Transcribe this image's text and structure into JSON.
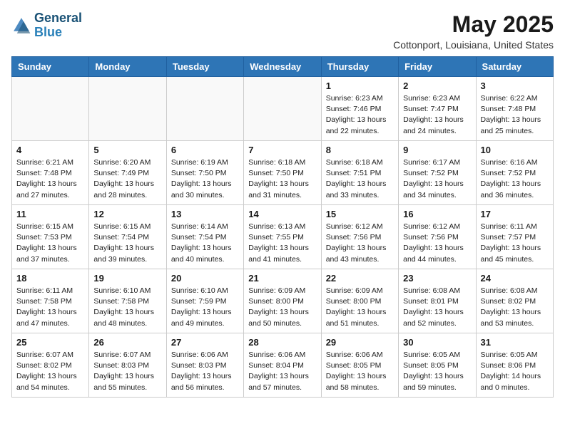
{
  "logo": {
    "line1": "General",
    "line2": "Blue"
  },
  "title": "May 2025",
  "location": "Cottonport, Louisiana, United States",
  "days_of_week": [
    "Sunday",
    "Monday",
    "Tuesday",
    "Wednesday",
    "Thursday",
    "Friday",
    "Saturday"
  ],
  "weeks": [
    [
      {
        "day": "",
        "info": ""
      },
      {
        "day": "",
        "info": ""
      },
      {
        "day": "",
        "info": ""
      },
      {
        "day": "",
        "info": ""
      },
      {
        "day": "1",
        "info": "Sunrise: 6:23 AM\nSunset: 7:46 PM\nDaylight: 13 hours\nand 22 minutes."
      },
      {
        "day": "2",
        "info": "Sunrise: 6:23 AM\nSunset: 7:47 PM\nDaylight: 13 hours\nand 24 minutes."
      },
      {
        "day": "3",
        "info": "Sunrise: 6:22 AM\nSunset: 7:48 PM\nDaylight: 13 hours\nand 25 minutes."
      }
    ],
    [
      {
        "day": "4",
        "info": "Sunrise: 6:21 AM\nSunset: 7:48 PM\nDaylight: 13 hours\nand 27 minutes."
      },
      {
        "day": "5",
        "info": "Sunrise: 6:20 AM\nSunset: 7:49 PM\nDaylight: 13 hours\nand 28 minutes."
      },
      {
        "day": "6",
        "info": "Sunrise: 6:19 AM\nSunset: 7:50 PM\nDaylight: 13 hours\nand 30 minutes."
      },
      {
        "day": "7",
        "info": "Sunrise: 6:18 AM\nSunset: 7:50 PM\nDaylight: 13 hours\nand 31 minutes."
      },
      {
        "day": "8",
        "info": "Sunrise: 6:18 AM\nSunset: 7:51 PM\nDaylight: 13 hours\nand 33 minutes."
      },
      {
        "day": "9",
        "info": "Sunrise: 6:17 AM\nSunset: 7:52 PM\nDaylight: 13 hours\nand 34 minutes."
      },
      {
        "day": "10",
        "info": "Sunrise: 6:16 AM\nSunset: 7:52 PM\nDaylight: 13 hours\nand 36 minutes."
      }
    ],
    [
      {
        "day": "11",
        "info": "Sunrise: 6:15 AM\nSunset: 7:53 PM\nDaylight: 13 hours\nand 37 minutes."
      },
      {
        "day": "12",
        "info": "Sunrise: 6:15 AM\nSunset: 7:54 PM\nDaylight: 13 hours\nand 39 minutes."
      },
      {
        "day": "13",
        "info": "Sunrise: 6:14 AM\nSunset: 7:54 PM\nDaylight: 13 hours\nand 40 minutes."
      },
      {
        "day": "14",
        "info": "Sunrise: 6:13 AM\nSunset: 7:55 PM\nDaylight: 13 hours\nand 41 minutes."
      },
      {
        "day": "15",
        "info": "Sunrise: 6:12 AM\nSunset: 7:56 PM\nDaylight: 13 hours\nand 43 minutes."
      },
      {
        "day": "16",
        "info": "Sunrise: 6:12 AM\nSunset: 7:56 PM\nDaylight: 13 hours\nand 44 minutes."
      },
      {
        "day": "17",
        "info": "Sunrise: 6:11 AM\nSunset: 7:57 PM\nDaylight: 13 hours\nand 45 minutes."
      }
    ],
    [
      {
        "day": "18",
        "info": "Sunrise: 6:11 AM\nSunset: 7:58 PM\nDaylight: 13 hours\nand 47 minutes."
      },
      {
        "day": "19",
        "info": "Sunrise: 6:10 AM\nSunset: 7:58 PM\nDaylight: 13 hours\nand 48 minutes."
      },
      {
        "day": "20",
        "info": "Sunrise: 6:10 AM\nSunset: 7:59 PM\nDaylight: 13 hours\nand 49 minutes."
      },
      {
        "day": "21",
        "info": "Sunrise: 6:09 AM\nSunset: 8:00 PM\nDaylight: 13 hours\nand 50 minutes."
      },
      {
        "day": "22",
        "info": "Sunrise: 6:09 AM\nSunset: 8:00 PM\nDaylight: 13 hours\nand 51 minutes."
      },
      {
        "day": "23",
        "info": "Sunrise: 6:08 AM\nSunset: 8:01 PM\nDaylight: 13 hours\nand 52 minutes."
      },
      {
        "day": "24",
        "info": "Sunrise: 6:08 AM\nSunset: 8:02 PM\nDaylight: 13 hours\nand 53 minutes."
      }
    ],
    [
      {
        "day": "25",
        "info": "Sunrise: 6:07 AM\nSunset: 8:02 PM\nDaylight: 13 hours\nand 54 minutes."
      },
      {
        "day": "26",
        "info": "Sunrise: 6:07 AM\nSunset: 8:03 PM\nDaylight: 13 hours\nand 55 minutes."
      },
      {
        "day": "27",
        "info": "Sunrise: 6:06 AM\nSunset: 8:03 PM\nDaylight: 13 hours\nand 56 minutes."
      },
      {
        "day": "28",
        "info": "Sunrise: 6:06 AM\nSunset: 8:04 PM\nDaylight: 13 hours\nand 57 minutes."
      },
      {
        "day": "29",
        "info": "Sunrise: 6:06 AM\nSunset: 8:05 PM\nDaylight: 13 hours\nand 58 minutes."
      },
      {
        "day": "30",
        "info": "Sunrise: 6:05 AM\nSunset: 8:05 PM\nDaylight: 13 hours\nand 59 minutes."
      },
      {
        "day": "31",
        "info": "Sunrise: 6:05 AM\nSunset: 8:06 PM\nDaylight: 14 hours\nand 0 minutes."
      }
    ]
  ]
}
